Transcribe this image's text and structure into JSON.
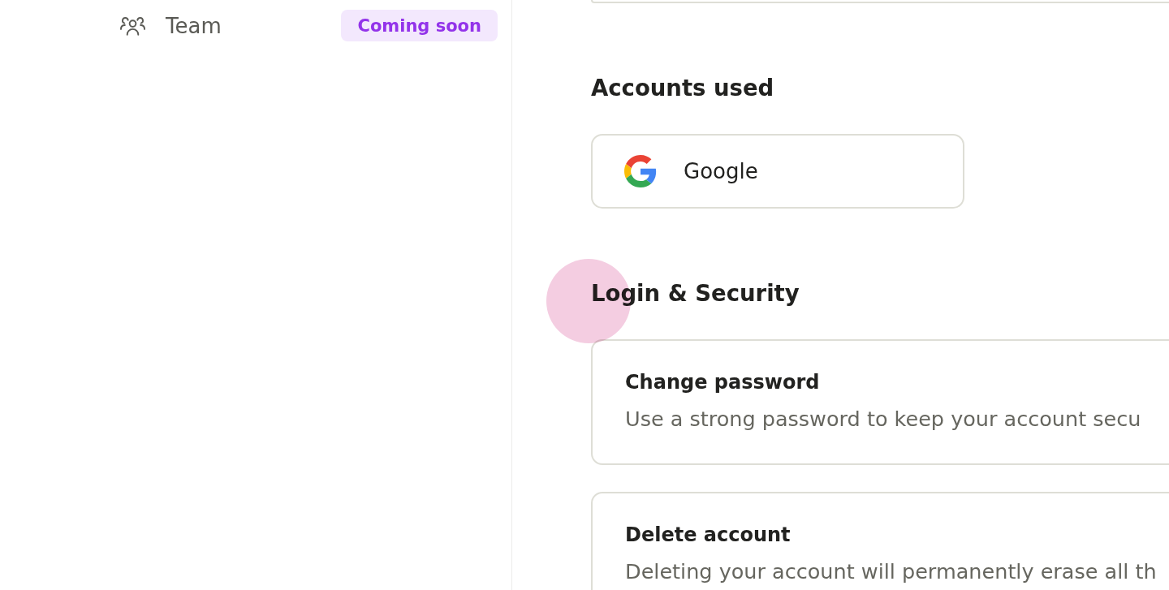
{
  "sidebar": {
    "items": [
      {
        "label": "Team",
        "badge": "Coming soon",
        "selected": false
      }
    ]
  },
  "accounts_used": {
    "title": "Accounts used",
    "accounts": [
      {
        "name": "Google"
      }
    ]
  },
  "login_security": {
    "title": "Login & Security",
    "cards": [
      {
        "title": "Change password",
        "description": "Use a strong password to keep your account secu"
      },
      {
        "title": "Delete account",
        "description": "Deleting your account will permanently erase all th"
      }
    ]
  }
}
